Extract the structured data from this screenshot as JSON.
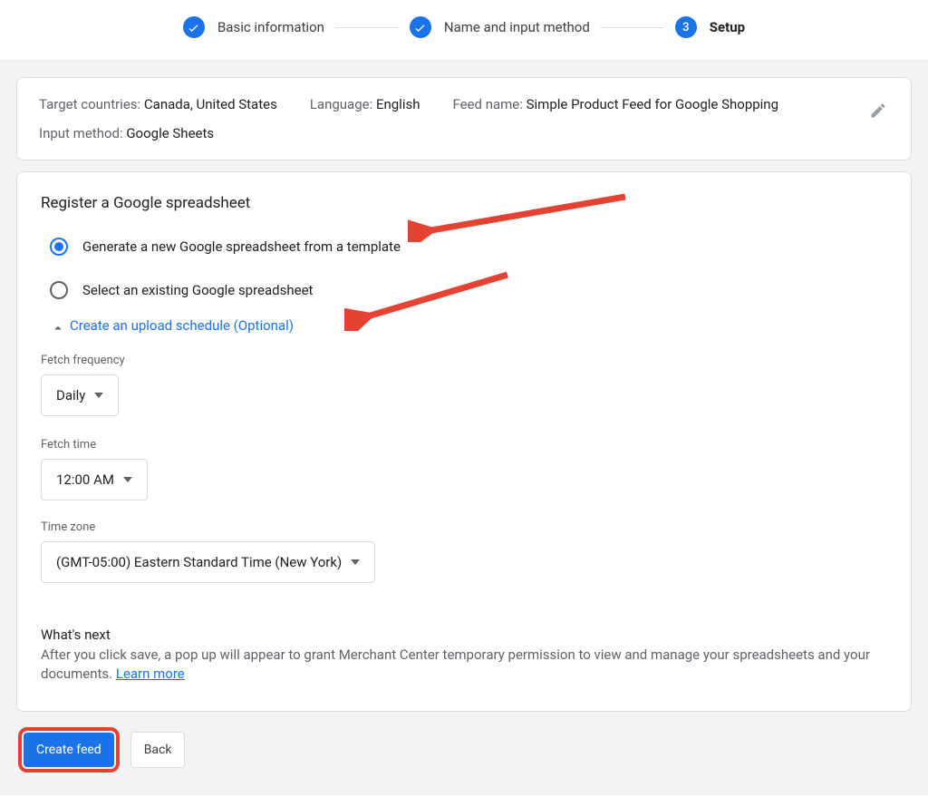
{
  "stepper": {
    "step1": "Basic information",
    "step2": "Name and input method",
    "step3_num": "3",
    "step3": "Setup"
  },
  "summary": {
    "countries_label": "Target countries: ",
    "countries_value": "Canada, United States",
    "language_label": "Language: ",
    "language_value": "English",
    "feedname_label": "Feed name: ",
    "feedname_value": "Simple Product Feed for Google Shopping",
    "method_label": "Input method: ",
    "method_value": "Google Sheets"
  },
  "setup": {
    "title": "Register a Google spreadsheet",
    "option_generate": "Generate a new Google spreadsheet from a template",
    "option_select": "Select an existing Google spreadsheet",
    "schedule_link": "Create an upload schedule (Optional)",
    "fetch_freq_label": "Fetch frequency",
    "fetch_freq_value": "Daily",
    "fetch_time_label": "Fetch time",
    "fetch_time_value": "12:00 AM",
    "timezone_label": "Time zone",
    "timezone_value": "(GMT-05:00) Eastern Standard Time (New York)",
    "whatsnext_title": "What's next",
    "whatsnext_body": "After you click save, a pop up will appear to grant Merchant Center temporary permission to view and manage your spreadsheets and your documents. ",
    "learn_more": "Learn more"
  },
  "actions": {
    "create": "Create feed",
    "back": "Back"
  }
}
